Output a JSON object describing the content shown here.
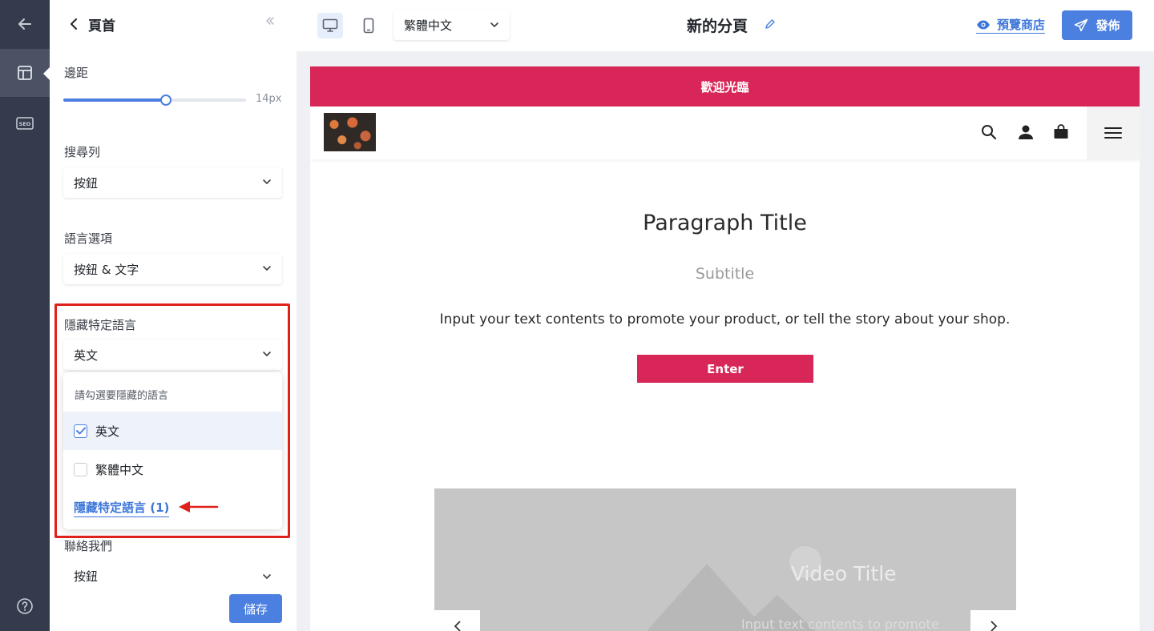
{
  "panel": {
    "title": "頁首",
    "margin": {
      "label": "邊距",
      "value_label": "14px",
      "slider_fraction": 0.56
    },
    "search_bar": {
      "label": "搜尋列",
      "value": "按鈕"
    },
    "language_options": {
      "label": "語言選項",
      "value": "按鈕 & 文字"
    },
    "hide_languages": {
      "label": "隱藏特定語言",
      "value": "英文",
      "dropdown": {
        "hint": "請勾選要隱藏的語言",
        "options": [
          {
            "label": "英文",
            "checked": true
          },
          {
            "label": "繁體中文",
            "checked": false
          }
        ],
        "summary_link": "隱藏特定語言 (1)"
      }
    },
    "contact_us": {
      "label": "聯絡我們",
      "value": "按鈕"
    },
    "save_label": "儲存"
  },
  "toolbar": {
    "language": "繁體中文",
    "page_name": "新的分頁",
    "preview_label": "預覽商店",
    "publish_label": "發佈"
  },
  "preview": {
    "announcement": "歡迎光臨",
    "paragraph_title": "Paragraph Title",
    "subtitle": "Subtitle",
    "body": "Input your text contents to promote your product, or tell the story about your shop.",
    "button_label": "Enter",
    "video_title": "Video Title",
    "video_text": "Input text contents to promote"
  },
  "colors": {
    "accent": "#4b7fe0",
    "brand": "#d72657",
    "rail": "#343b4c",
    "highlight": "#e0201b"
  }
}
